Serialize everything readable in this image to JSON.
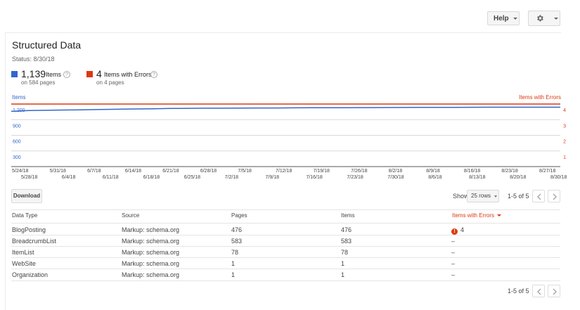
{
  "header": {
    "help_label": "Help"
  },
  "page": {
    "title": "Structured Data",
    "status": "Status: 8/30/18"
  },
  "metrics": {
    "items": {
      "value": "1,139",
      "label": "Items",
      "sub": "on 584 pages",
      "color": "#3366cc"
    },
    "errors": {
      "value": "4",
      "label": "Items with Errors",
      "sub": "on 4 pages",
      "color": "#dc3912"
    }
  },
  "chart_data": {
    "type": "line",
    "y_left_title": "Items",
    "y_right_title": "Items with Errors",
    "y_left_ticks": [
      "1,200",
      "900",
      "600",
      "300"
    ],
    "y_right_ticks": [
      "4",
      "3",
      "2",
      "1"
    ],
    "y_left_range": [
      0,
      1200
    ],
    "y_right_range": [
      0,
      4
    ],
    "x_labels_top": [
      "5/24/18",
      "5/31/18",
      "6/7/18",
      "6/14/18",
      "6/21/18",
      "6/28/18",
      "7/5/18",
      "7/12/18",
      "7/19/18",
      "7/26/18",
      "8/2/18",
      "8/9/18",
      "8/16/18",
      "8/23/18",
      "8/27/18"
    ],
    "x_labels_bottom": [
      "5/28/18",
      "6/4/18",
      "6/11/18",
      "6/18/18",
      "6/25/18",
      "7/2/18",
      "7/9/18",
      "7/16/18",
      "7/23/18",
      "7/30/18",
      "8/6/18",
      "8/13/18",
      "8/20/18",
      "8/30/18"
    ],
    "series": [
      {
        "name": "Items",
        "color": "#3366cc",
        "values": [
          1060,
          1075,
          1080,
          1085,
          1090,
          1095,
          1100,
          1105,
          1110,
          1115,
          1118,
          1120,
          1120,
          1122,
          1124,
          1125,
          1127,
          1128,
          1130,
          1130,
          1131,
          1132,
          1134,
          1135,
          1136,
          1137,
          1138,
          1139,
          1139,
          1139,
          1139,
          1139
        ]
      },
      {
        "name": "Items with Errors",
        "color": "#dc3912",
        "values": [
          4,
          4,
          4,
          4,
          4,
          4,
          4,
          4,
          4,
          4,
          4,
          4,
          4,
          4,
          4,
          4,
          4,
          4,
          4,
          4,
          4,
          4,
          4,
          4,
          4,
          4,
          4,
          4,
          4,
          4,
          4,
          4
        ]
      }
    ],
    "grid": true
  },
  "toolbar": {
    "download_label": "Download",
    "show_label": "Show",
    "rows_value": "25 rows",
    "range_label": "1-5 of 5"
  },
  "table": {
    "headers": [
      "Data Type",
      "Source",
      "Pages",
      "Items",
      "Items with Errors"
    ],
    "rows": [
      {
        "type": "BlogPosting",
        "source": "Markup: schema.org",
        "pages": "476",
        "items": "476",
        "errors": "4"
      },
      {
        "type": "BreadcrumbList",
        "source": "Markup: schema.org",
        "pages": "583",
        "items": "583",
        "errors": "–"
      },
      {
        "type": "ItemList",
        "source": "Markup: schema.org",
        "pages": "78",
        "items": "78",
        "errors": "–"
      },
      {
        "type": "WebSite",
        "source": "Markup: schema.org",
        "pages": "1",
        "items": "1",
        "errors": "–"
      },
      {
        "type": "Organization",
        "source": "Markup: schema.org",
        "pages": "1",
        "items": "1",
        "errors": "–"
      }
    ]
  }
}
